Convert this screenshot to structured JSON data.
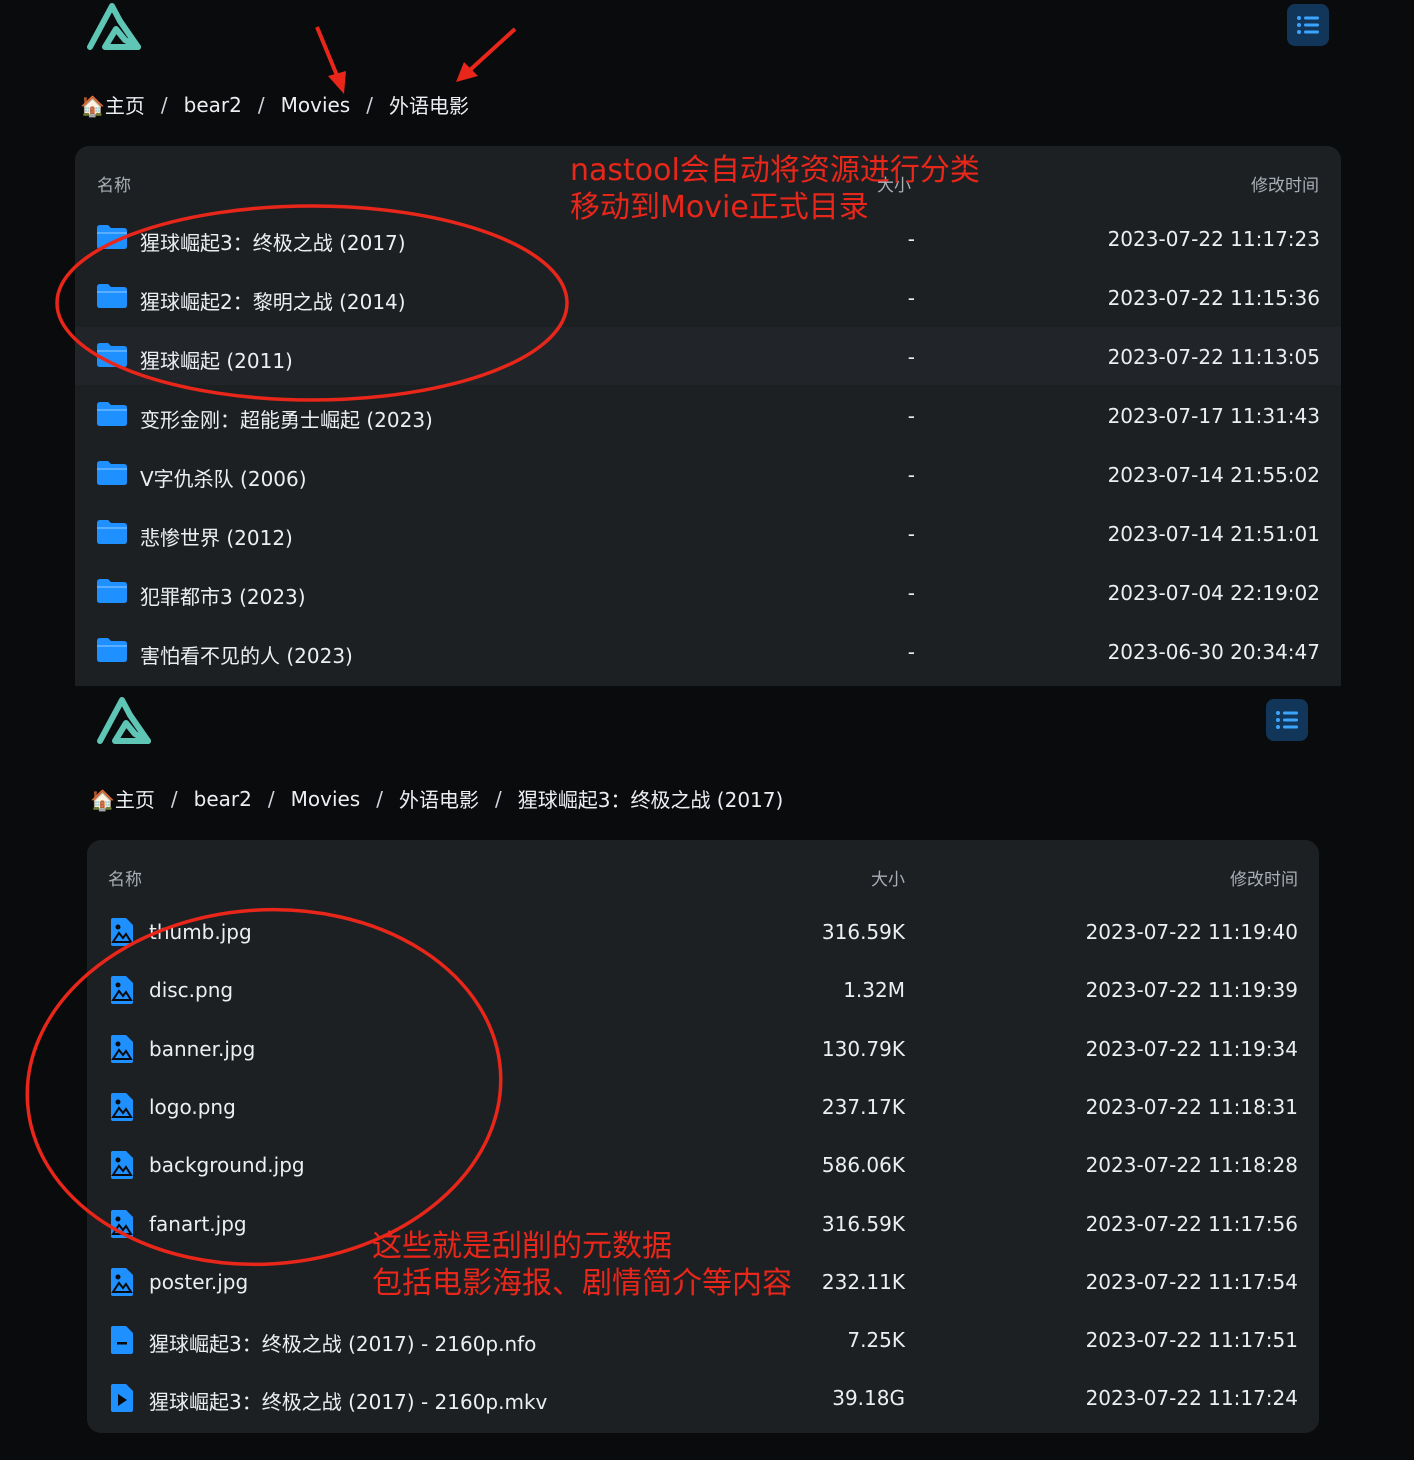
{
  "top": {
    "breadcrumb": [
      {
        "label": "🏠主页"
      },
      {
        "label": "bear2"
      },
      {
        "label": "Movies"
      },
      {
        "label": "外语电影"
      }
    ],
    "separator": "/",
    "columns": {
      "name": "名称",
      "size": "大小",
      "modified": "修改时间"
    },
    "rows": [
      {
        "name": "猩球崛起3：终极之战 (2017)",
        "size": "-",
        "modified": "2023-07-22 11:17:23"
      },
      {
        "name": "猩球崛起2：黎明之战 (2014)",
        "size": "-",
        "modified": "2023-07-22 11:15:36"
      },
      {
        "name": "猩球崛起 (2011)",
        "size": "-",
        "modified": "2023-07-22 11:13:05"
      },
      {
        "name": "变形金刚：超能勇士崛起 (2023)",
        "size": "-",
        "modified": "2023-07-17 11:31:43"
      },
      {
        "name": "V字仇杀队 (2006)",
        "size": "-",
        "modified": "2023-07-14 21:55:02"
      },
      {
        "name": "悲惨世界 (2012)",
        "size": "-",
        "modified": "2023-07-14 21:51:01"
      },
      {
        "name": "犯罪都市3 (2023)",
        "size": "-",
        "modified": "2023-07-04 22:19:02"
      },
      {
        "name": "害怕看不见的人 (2023)",
        "size": "-",
        "modified": "2023-06-30 20:34:47"
      }
    ],
    "annotation": [
      "nastool会自动将资源进行分类",
      "移动到Movie正式目录"
    ]
  },
  "bottom": {
    "breadcrumb": [
      {
        "label": "🏠主页"
      },
      {
        "label": "bear2"
      },
      {
        "label": "Movies"
      },
      {
        "label": "外语电影"
      },
      {
        "label": "猩球崛起3：终极之战 (2017)"
      }
    ],
    "separator": "/",
    "columns": {
      "name": "名称",
      "size": "大小",
      "modified": "修改时间"
    },
    "rows": [
      {
        "name": "thumb.jpg",
        "size": "316.59K",
        "modified": "2023-07-22 11:19:40",
        "icon": "image-file-icon"
      },
      {
        "name": "disc.png",
        "size": "1.32M",
        "modified": "2023-07-22 11:19:39",
        "icon": "image-file-icon"
      },
      {
        "name": "banner.jpg",
        "size": "130.79K",
        "modified": "2023-07-22 11:19:34",
        "icon": "image-file-icon"
      },
      {
        "name": "logo.png",
        "size": "237.17K",
        "modified": "2023-07-22 11:18:31",
        "icon": "image-file-icon"
      },
      {
        "name": "background.jpg",
        "size": "586.06K",
        "modified": "2023-07-22 11:18:28",
        "icon": "image-file-icon"
      },
      {
        "name": "fanart.jpg",
        "size": "316.59K",
        "modified": "2023-07-22 11:17:56",
        "icon": "image-file-icon"
      },
      {
        "name": "poster.jpg",
        "size": "232.11K",
        "modified": "2023-07-22 11:17:54",
        "icon": "image-file-icon"
      },
      {
        "name": "猩球崛起3：终极之战 (2017) - 2160p.nfo",
        "size": "7.25K",
        "modified": "2023-07-22 11:17:51",
        "icon": "document-file-icon"
      },
      {
        "name": "猩球崛起3：终极之战 (2017) - 2160p.mkv",
        "size": "39.18G",
        "modified": "2023-07-22 11:17:24",
        "icon": "video-file-icon"
      }
    ],
    "annotation": [
      "这些就是刮削的元数据",
      "包括电影海报、剧情简介等内容"
    ]
  },
  "colors": {
    "accent": "#1e90ff",
    "annotation": "#e8261a",
    "card": "#1d2023",
    "background": "#0a0b0d"
  }
}
